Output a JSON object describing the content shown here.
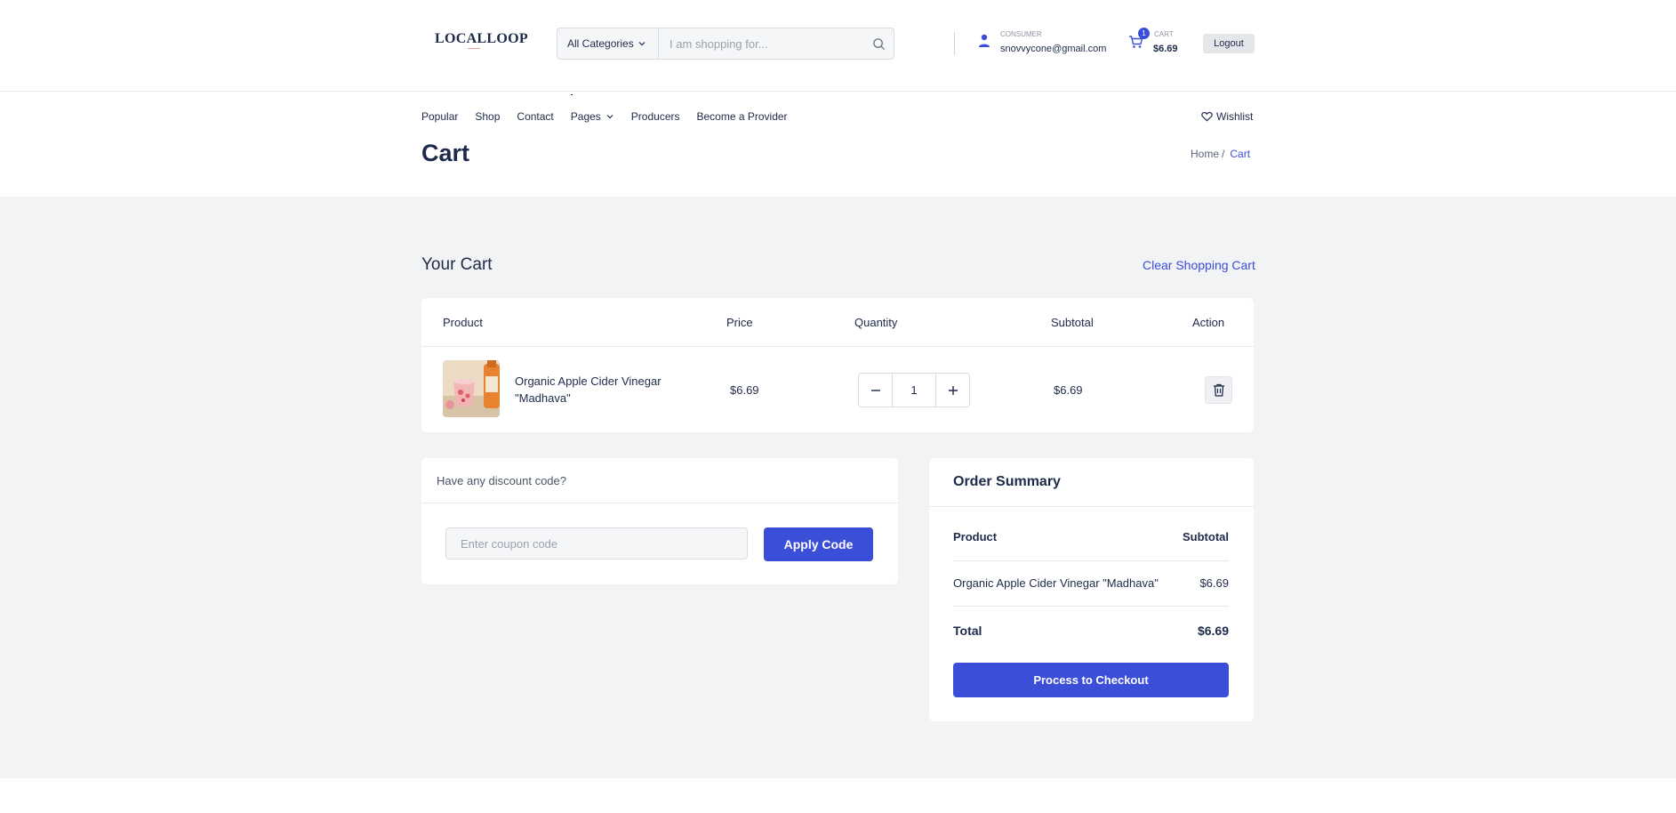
{
  "header": {
    "logo": "LOCALLOOP",
    "search": {
      "category": "All Categories",
      "placeholder": "I am shopping for..."
    },
    "user": {
      "role": "CONSUMER",
      "email": "snovvycone@gmail.com"
    },
    "cart": {
      "badge": "1",
      "label": "CART",
      "amount": "$6.69"
    },
    "logout": "Logout"
  },
  "nav": {
    "items": [
      "Popular",
      "Shop",
      "Contact",
      "Pages",
      "Producers",
      "Become a Provider"
    ],
    "wishlist": "Wishlist"
  },
  "page": {
    "title": "Cart",
    "breadcrumb": {
      "home": "Home",
      "separator": "/",
      "current": "Cart"
    }
  },
  "cart": {
    "heading": "Your Cart",
    "clear_label": "Clear Shopping Cart",
    "columns": [
      "Product",
      "Price",
      "Quantity",
      "Subtotal",
      "Action"
    ],
    "items": [
      {
        "name": "Organic Apple Cider Vinegar \"Madhava\"",
        "price": "$6.69",
        "quantity": "1",
        "subtotal": "$6.69"
      }
    ]
  },
  "discount": {
    "title": "Have any discount code?",
    "placeholder": "Enter coupon code",
    "apply_label": "Apply Code"
  },
  "summary": {
    "title": "Order Summary",
    "header_product": "Product",
    "header_subtotal": "Subtotal",
    "items": [
      {
        "name": "Organic Apple Cider Vinegar \"Madhava\"",
        "subtotal": "$6.69"
      }
    ],
    "total_label": "Total",
    "total_value": "$6.69",
    "checkout_label": "Process to Checkout"
  },
  "colors": {
    "accent": "#3a4ed8",
    "text": "#1e2a4a",
    "background": "#f2f3f5"
  }
}
